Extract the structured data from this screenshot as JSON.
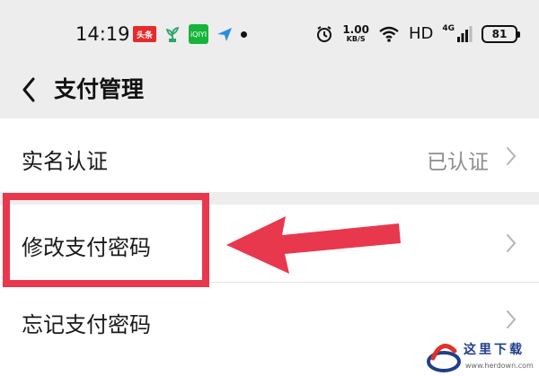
{
  "status_bar": {
    "time": "14:19",
    "notification_icons": [
      "toutiao-icon",
      "plant-icon",
      "iqiyi-icon",
      "send-icon",
      "more-dot-icon"
    ],
    "toutiao_label": "头条",
    "iqiyi_label": "iQIYI",
    "net_speed": "1.00",
    "net_speed_unit": "KB/S",
    "hd_label": "HD",
    "network_type": "4G",
    "battery": "81"
  },
  "header": {
    "back_icon": "chevron-left-icon",
    "title": "支付管理"
  },
  "settings_list": [
    {
      "label": "实名认证",
      "value": "已认证"
    },
    {
      "label": "修改支付密码",
      "value": ""
    },
    {
      "label": "忘记支付密码",
      "value": ""
    }
  ],
  "annotation": {
    "color": "#e8384e"
  },
  "watermark": {
    "name": "这里下载",
    "url": "www.herdown.com"
  }
}
